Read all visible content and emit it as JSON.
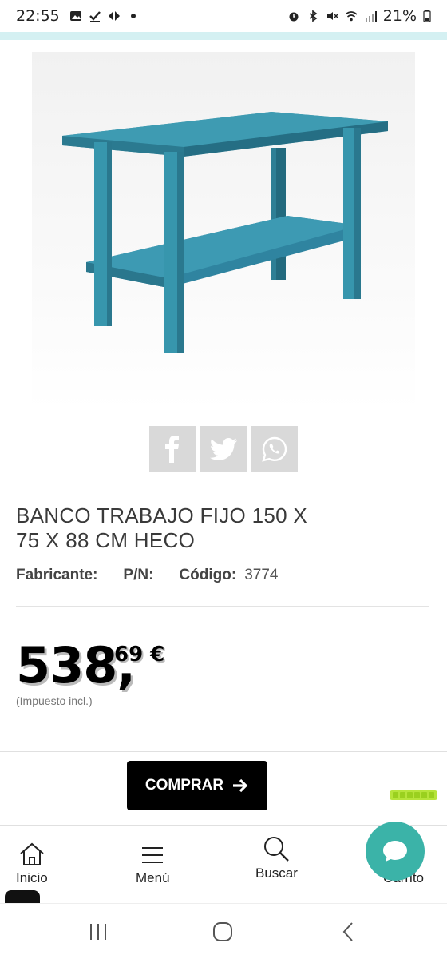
{
  "status_bar": {
    "time": "22:55",
    "battery": "21%",
    "icons": [
      "image-icon",
      "check-download-icon",
      "carrefour-icon",
      "dot-icon",
      "alarm-icon",
      "bluetooth-icon",
      "mute-icon",
      "wifi-icon",
      "signal-icon",
      "battery-icon"
    ]
  },
  "product": {
    "image_icon": "workbench-image",
    "table_color": "#2e7f95",
    "title": "BANCO TRABAJO FIJO 150 X 75 X 88 CM HECO",
    "manufacturer_label": "Fabricante:",
    "pn_label": "P/N:",
    "code_label": "Código:",
    "code_value": "3774",
    "price_integer": "538,",
    "price_decimal": "69 €",
    "tax_note": "(Impuesto incl.)"
  },
  "share": {
    "buttons": [
      "facebook-icon",
      "twitter-icon",
      "whatsapp-icon"
    ],
    "button_bg": "#d9d9d9"
  },
  "actions": {
    "buy_label": "COMPRAR",
    "buy_icon": "arrow-right-icon"
  },
  "bottom_nav": {
    "items": [
      {
        "label": "Inicio",
        "icon": "home-icon"
      },
      {
        "label": "Menú",
        "icon": "hamburger-icon"
      },
      {
        "label": "Buscar",
        "icon": "search-icon"
      },
      {
        "label": "Carrito",
        "icon": "cart-icon"
      }
    ],
    "chat_icon": "chat-icon",
    "chat_color": "#3bb3a8"
  },
  "system_nav": {
    "icons": [
      "recents-icon",
      "home-circle-icon",
      "back-icon"
    ]
  }
}
